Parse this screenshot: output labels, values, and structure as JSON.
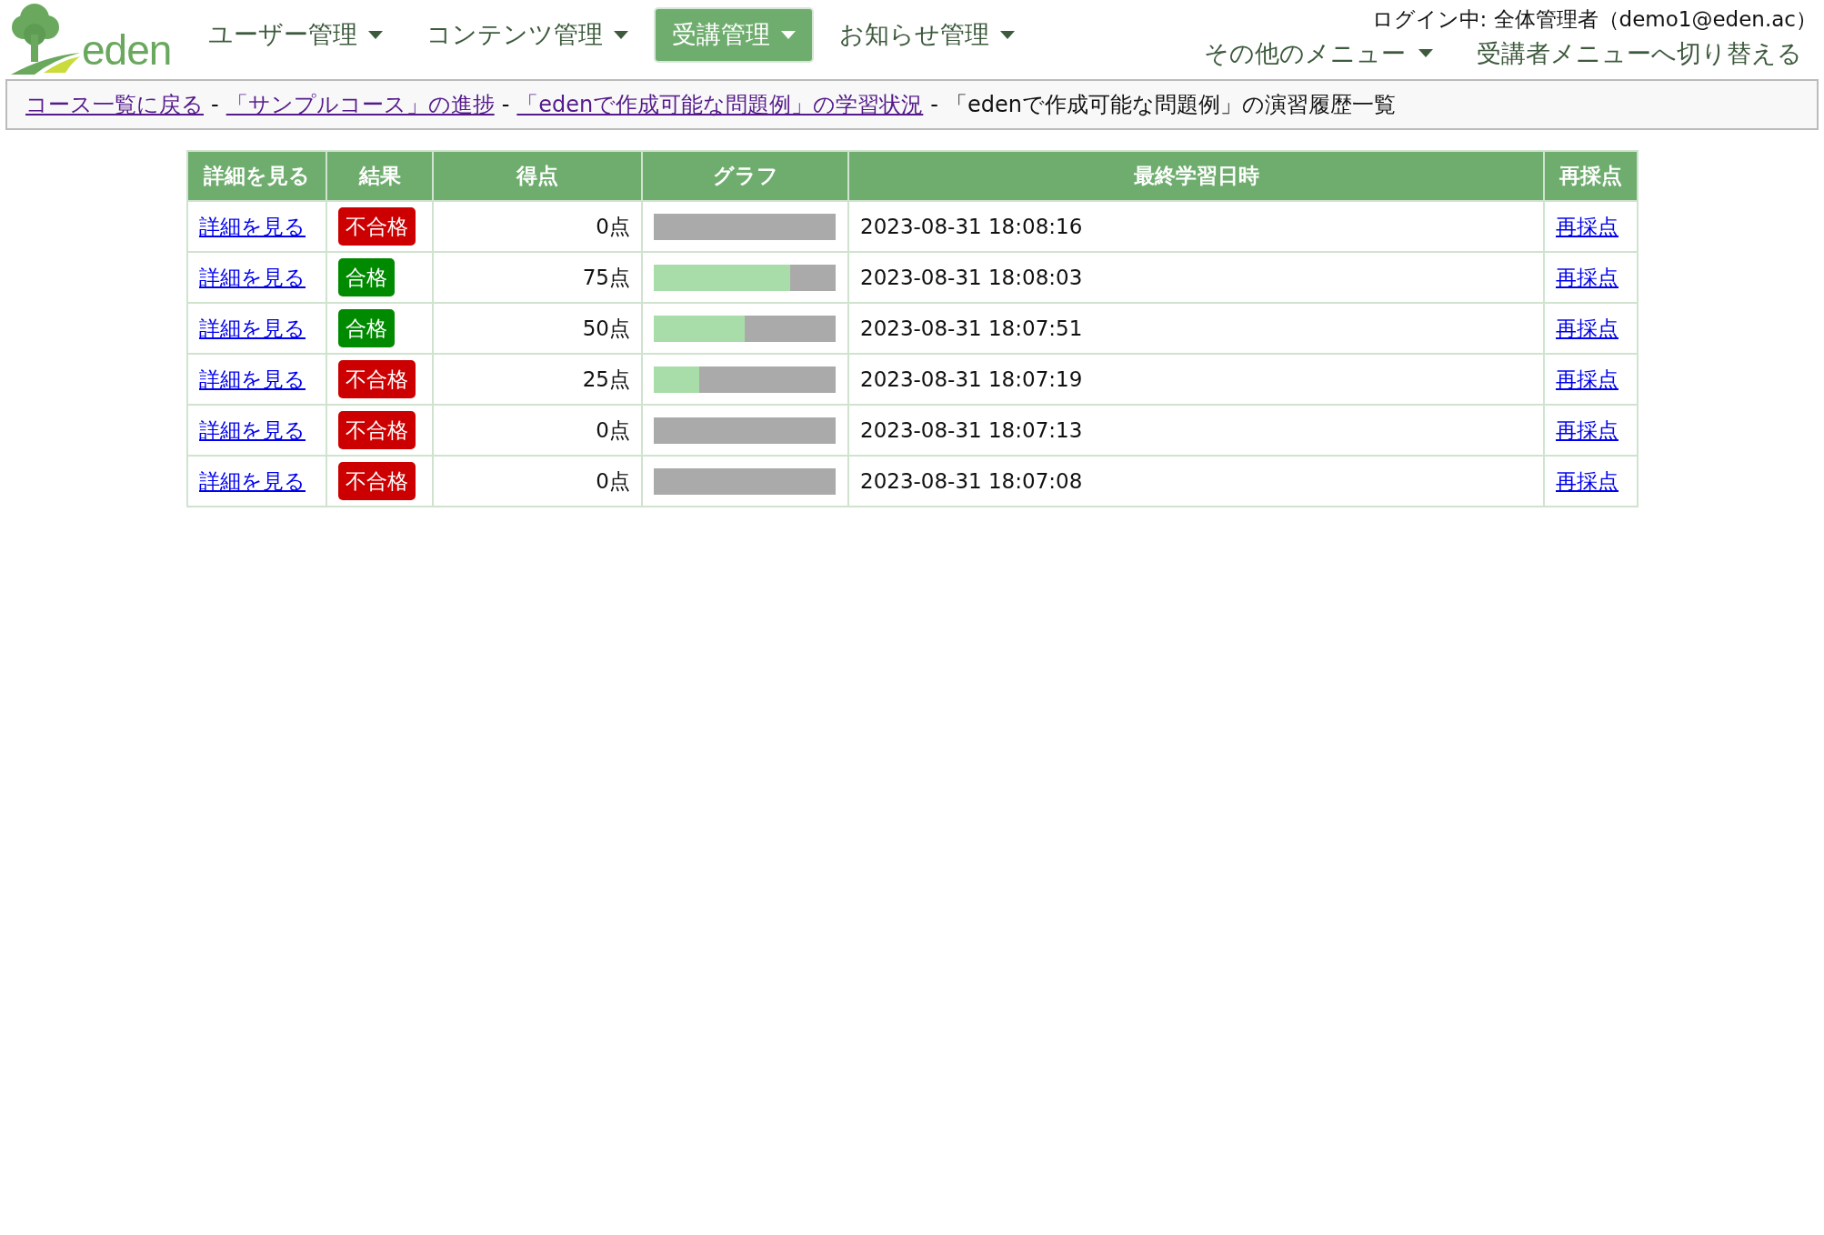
{
  "logo": {
    "text": "eden"
  },
  "nav": [
    {
      "label": "ユーザー管理",
      "selected": false
    },
    {
      "label": "コンテンツ管理",
      "selected": false
    },
    {
      "label": "受講管理",
      "selected": true
    },
    {
      "label": "お知らせ管理",
      "selected": false
    }
  ],
  "login_status": "ログイン中: 全体管理者（demo1@eden.ac）",
  "other_menu": "その他のメニュー",
  "switch_link": "受講者メニューへ切り替える",
  "breadcrumb": {
    "separators": [
      "-",
      "-",
      "-"
    ],
    "links": [
      "コース一覧に戻る",
      "「サンプルコース」の進捗",
      "「edenで作成可能な問題例」の学習状況"
    ],
    "current": "「edenで作成可能な問題例」の演習履歴一覧"
  },
  "table": {
    "columns": [
      "詳細を見る",
      "結果",
      "得点",
      "グラフ",
      "最終学習日時",
      "再採点"
    ],
    "rows": [
      {
        "detail": "詳細を見る",
        "result": {
          "label": "不合格",
          "passed": false
        },
        "score": "0点",
        "level": 0,
        "date": "2023-08-31 18:08:16",
        "rescore": "再採点"
      },
      {
        "detail": "詳細を見る",
        "result": {
          "label": "合格",
          "passed": true
        },
        "score": "75点",
        "level": 0.75,
        "date": "2023-08-31 18:08:03",
        "rescore": "再採点"
      },
      {
        "detail": "詳細を見る",
        "result": {
          "label": "合格",
          "passed": true
        },
        "score": "50点",
        "level": 0.5,
        "date": "2023-08-31 18:07:51",
        "rescore": "再採点"
      },
      {
        "detail": "詳細を見る",
        "result": {
          "label": "不合格",
          "passed": false
        },
        "score": "25点",
        "level": 0.25,
        "date": "2023-08-31 18:07:19",
        "rescore": "再採点"
      },
      {
        "detail": "詳細を見る",
        "result": {
          "label": "不合格",
          "passed": false
        },
        "score": "0点",
        "level": 0,
        "date": "2023-08-31 18:07:13",
        "rescore": "再採点"
      },
      {
        "detail": "詳細を見る",
        "result": {
          "label": "不合格",
          "passed": false
        },
        "score": "0点",
        "level": 0,
        "date": "2023-08-31 18:07:08",
        "rescore": "再採点"
      }
    ]
  }
}
